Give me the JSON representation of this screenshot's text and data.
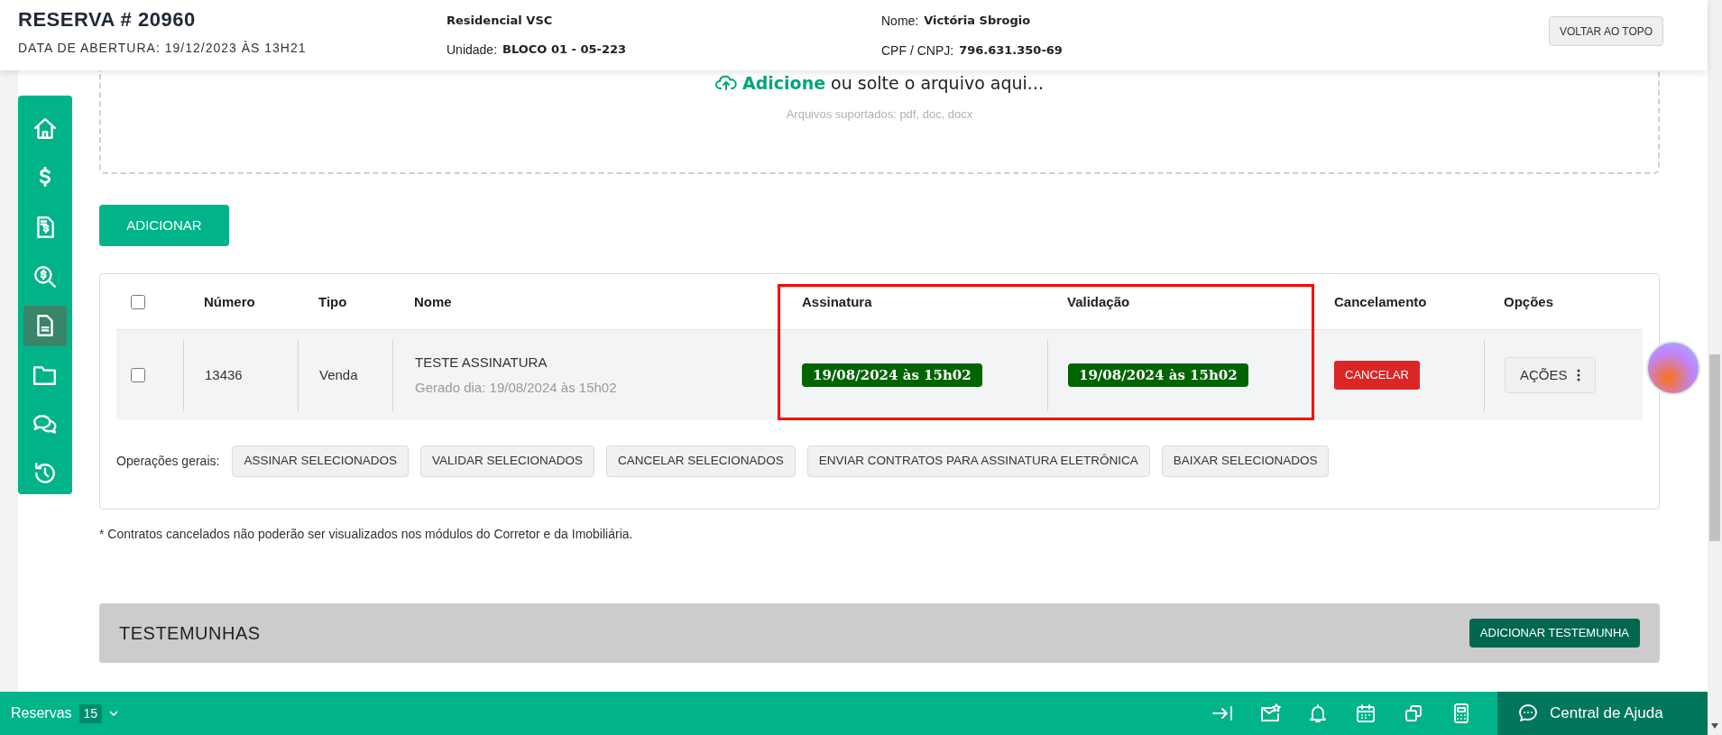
{
  "header": {
    "title": "RESERVA # 20960",
    "subtitle": "DATA DE ABERTURA: 19/12/2023 ÀS 13H21",
    "project": "Residencial VSC",
    "unit_label": "Unidade:",
    "unit_value": "BLOCO 01 - 05-223",
    "name_label": "Nome:",
    "name_value": "Victória Sbrogio",
    "cpf_label": "CPF / CNPJ:",
    "cpf_value": "796.631.350-69",
    "top_button": "VOLTAR AO TOPO"
  },
  "sidebar": {
    "items": [
      {
        "kind": "home",
        "selected": false
      },
      {
        "kind": "dollar",
        "selected": false
      },
      {
        "kind": "invoice",
        "selected": false
      },
      {
        "kind": "search-dollar",
        "selected": false
      },
      {
        "kind": "document",
        "selected": true
      },
      {
        "kind": "folder",
        "selected": false
      },
      {
        "kind": "chat",
        "selected": false
      },
      {
        "kind": "history",
        "selected": false
      }
    ]
  },
  "upload": {
    "action": "Adicione",
    "text": "ou solte o arquivo aqui...",
    "hint": "Arquivos suportados: pdf, doc, docx"
  },
  "add_button": "ADICIONAR",
  "table": {
    "select_all_checked": false,
    "columns": [
      "Número",
      "Tipo",
      "Nome",
      "Assinatura",
      "Validação",
      "Cancelamento",
      "Opções"
    ],
    "rows": [
      {
        "checked": false,
        "number": "13436",
        "type": "Venda",
        "name": "TESTE ASSINATURA",
        "generated": "Gerado dia: 19/08/2024 às 15h02",
        "signature": "19/08/2024 às 15h02",
        "validation": "19/08/2024 às 15h02",
        "cancel_button": "CANCELAR",
        "options_button": "AÇÕES"
      }
    ],
    "operations_label": "Operações gerais:",
    "operations": [
      "ASSINAR SELECIONADOS",
      "VALIDAR SELECIONADOS",
      "CANCELAR SELECIONADOS",
      "ENVIAR CONTRATOS PARA ASSINATURA ELETRÔNICA",
      "BAIXAR SELECIONADOS"
    ]
  },
  "note": "* Contratos cancelados não poderão ser visualizados nos módulos do Corretor e da Imobiliária.",
  "witnesses": {
    "title": "TESTEMUNHAS",
    "button": "ADICIONAR TESTEMUNHA"
  },
  "bottom_bar": {
    "label": "Reservas",
    "count": "15",
    "tools": [
      {
        "kind": "collapse"
      },
      {
        "kind": "mail"
      },
      {
        "kind": "bell"
      },
      {
        "kind": "calendar"
      },
      {
        "kind": "windows"
      },
      {
        "kind": "calculator"
      }
    ],
    "help": "Central de Ajuda"
  }
}
